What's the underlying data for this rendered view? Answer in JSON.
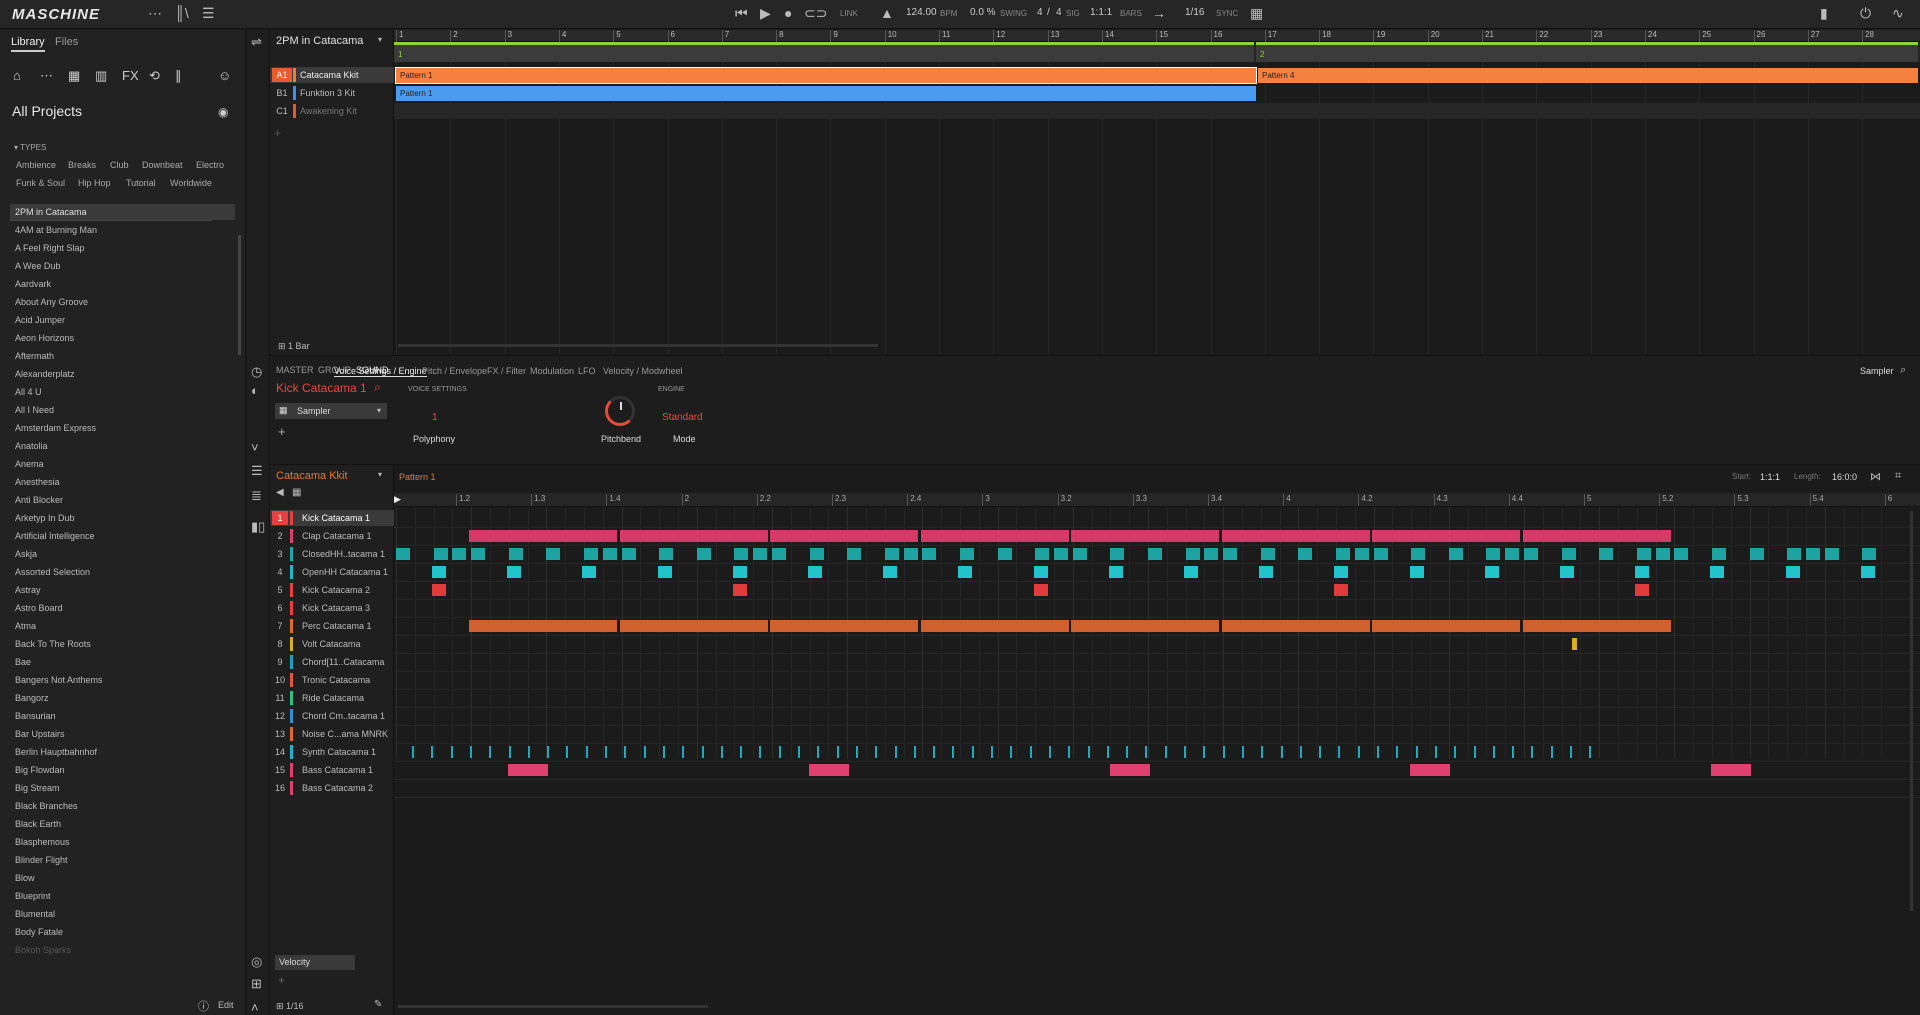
{
  "app": {
    "brand": "MASCHINE"
  },
  "transport": {
    "bpm": "124.00",
    "bpm_label": "BPM",
    "swing": "0.0 %",
    "swing_label": "SWING",
    "sig_num": "4",
    "sig_sep": "/",
    "sig_den": "4",
    "sig_label": "SIG",
    "pos": "1:1:1",
    "pos_label": "BARS",
    "link": "LINK",
    "quant": "1/16",
    "sync": "SYNC"
  },
  "library": {
    "tab_library": "Library",
    "tab_files": "Files",
    "title": "All Projects",
    "types_label": "TYPES",
    "tags": [
      "Ambience",
      "Breaks",
      "Club",
      "Downbeat",
      "Electro",
      "Funk & Soul",
      "Hip Hop",
      "Tutorial",
      "Worldwide"
    ],
    "projects": [
      "2PM in Catacama",
      "4AM at Burning Man",
      "A Feel Right Slap",
      "A Wee Dub",
      "Aardvark",
      "About Any Groove",
      "Acid Jumper",
      "Aeon Horizons",
      "Aftermath",
      "Alexanderplatz",
      "All 4 U",
      "All I Need",
      "Amsterdam Express",
      "Anatolia",
      "Anema",
      "Anesthesia",
      "Anti Blocker",
      "Arketyp In Dub",
      "Artificial Intelligence",
      "Askja",
      "Assorted Selection",
      "Astray",
      "Astro Board",
      "Atma",
      "Back To The Roots",
      "Bae",
      "Bangers Not Anthems",
      "Bangorz",
      "Bansurian",
      "Bar Upstairs",
      "Berlin Hauptbahnhof",
      "Big Flowdan",
      "Big Stream",
      "Black Branches",
      "Black Earth",
      "Blasphemous",
      "Blinder Flight",
      "Blow",
      "Blueprint",
      "Blumental",
      "Body Fatale",
      "Bokoh Sparks"
    ],
    "edit": "Edit"
  },
  "arranger": {
    "project": "2PM in Catacama",
    "bar_len": "1 Bar",
    "ruler": [
      "1",
      "2",
      "3",
      "4",
      "5",
      "6",
      "7",
      "8",
      "9",
      "10",
      "11",
      "12",
      "13",
      "14",
      "15",
      "16",
      "17",
      "18",
      "19",
      "20",
      "21",
      "22",
      "23",
      "24",
      "25",
      "26",
      "27",
      "28"
    ],
    "scenes": [
      "1",
      "2"
    ],
    "groups": [
      {
        "letter": "A1",
        "name": "Catacama Kkit",
        "color": "#f07a3a"
      },
      {
        "letter": "B1",
        "name": "Funktion 3 Kit",
        "color": "#3a8ff0"
      },
      {
        "letter": "C1",
        "name": "Awakening Kit",
        "color": "#e05a2a"
      }
    ],
    "patterns": [
      "Pattern 1",
      "Pattern 4",
      "Pattern 1"
    ]
  },
  "sound": {
    "tabs": [
      "MASTER",
      "GROUP",
      "SOUND"
    ],
    "name": "Kick Catacama 1",
    "plugin": "Sampler",
    "param_tabs": [
      "Voice Settings / Engine",
      "Pitch / Envelope",
      "FX / Filter",
      "Modulation",
      "LFO",
      "Velocity / Modwheel"
    ],
    "voice_label": "VOICE SETTINGS",
    "engine_label": "ENGINE",
    "polyphony": "1",
    "polyphony_label": "Polyphony",
    "pitchbend_label": "Pitchbend",
    "mode": "Standard",
    "mode_label": "Mode",
    "right_plugin": "Sampler"
  },
  "pattern": {
    "group": "Catacama Kkit",
    "name": "Pattern 1",
    "start_label": "Start:",
    "start": "1:1:1",
    "length_label": "Length:",
    "length": "16:0:0",
    "velocity": "Velocity",
    "quant": "1/16",
    "ruler": [
      "1.2",
      "1.3",
      "1.4",
      "2",
      "2.2",
      "2.3",
      "2.4",
      "3",
      "3.2",
      "3.3",
      "3.4",
      "4",
      "4.2",
      "4.3",
      "4.4",
      "5",
      "5.2",
      "5.3",
      "5.4",
      "6"
    ],
    "sounds": [
      {
        "n": "1",
        "name": "Kick Catacama 1",
        "color": "#e84040"
      },
      {
        "n": "2",
        "name": "Clap Catacama 1",
        "color": "#d6406a"
      },
      {
        "n": "3",
        "name": "ClosedHH..tacama 1",
        "color": "#20a8a8"
      },
      {
        "n": "4",
        "name": "OpenHH Catacama 1",
        "color": "#20b8c0"
      },
      {
        "n": "5",
        "name": "Kick Catacama 2",
        "color": "#e84040"
      },
      {
        "n": "6",
        "name": "Kick Catacama 3",
        "color": "#e84040"
      },
      {
        "n": "7",
        "name": "Perc Catacama 1",
        "color": "#e06a30"
      },
      {
        "n": "8",
        "name": "Volt Catacama",
        "color": "#d6b020"
      },
      {
        "n": "9",
        "name": "Chord[11..Catacama",
        "color": "#20a0c0"
      },
      {
        "n": "10",
        "name": "Tronic Catacama",
        "color": "#e05a40"
      },
      {
        "n": "11",
        "name": "Ride Catacama",
        "color": "#30c080"
      },
      {
        "n": "12",
        "name": "Chord Cm..tacama 1",
        "color": "#3090d0"
      },
      {
        "n": "13",
        "name": "Noise C...ama MNRK",
        "color": "#e06a30"
      },
      {
        "n": "14",
        "name": "Synth Catacama 1",
        "color": "#20b0c8"
      },
      {
        "n": "15",
        "name": "Bass Catacama 1",
        "color": "#e04070"
      },
      {
        "n": "16",
        "name": "Bass Catacama 2",
        "color": "#e04070"
      }
    ]
  }
}
